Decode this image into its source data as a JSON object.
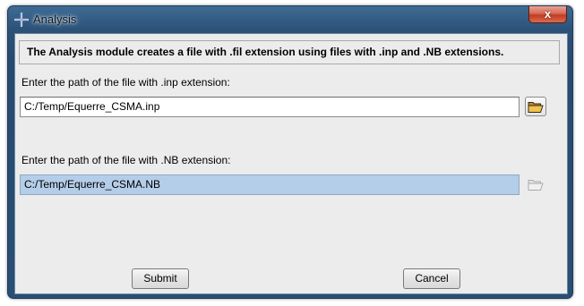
{
  "window": {
    "title": "Analysis",
    "close_label": "x"
  },
  "header": {
    "text": "The Analysis module creates a file with .fil extension using files with .inp and .NB extensions."
  },
  "inp": {
    "label": "Enter the path of the file with .inp extension:",
    "value": "C:/Temp/Equerre_CSMA.inp"
  },
  "nb": {
    "label": "Enter the path of the file with .NB extension:",
    "value": "C:/Temp/Equerre_CSMA.NB"
  },
  "buttons": {
    "submit": "Submit",
    "cancel": "Cancel"
  },
  "icons": {
    "title": "cross-move-icon",
    "browse_inp": "open-folder-icon",
    "browse_nb": "open-folder-icon"
  },
  "colors": {
    "selection": "#b4cde8",
    "titlebar": "#2c5278",
    "close": "#c23b22"
  }
}
